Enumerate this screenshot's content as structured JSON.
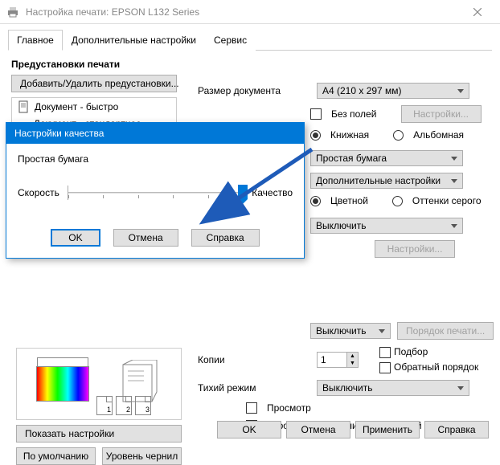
{
  "titlebar": {
    "title": "Настройка печати: EPSON L132 Series"
  },
  "tabs": {
    "main": "Главное",
    "advanced": "Дополнительные настройки",
    "service": "Сервис"
  },
  "presets": {
    "title": "Предустановки печати",
    "add_remove": "Добавить/Удалить предустановки...",
    "items": [
      {
        "label": "Документ - быстро"
      },
      {
        "label": "Документ - стандартное качество"
      }
    ]
  },
  "doc_size": {
    "label": "Размер документа",
    "value": "А4 (210 x 297 мм)"
  },
  "borderless": {
    "label": "Без полей",
    "settings": "Настройки..."
  },
  "orientation": {
    "portrait": "Книжная",
    "landscape": "Альбомная"
  },
  "paper_type": {
    "value": "Простая бумага"
  },
  "advanced_settings": {
    "value": "Дополнительные настройки"
  },
  "color_mode": {
    "color": "Цветной",
    "grayscale": "Оттенки серого"
  },
  "off1": {
    "value": "Выключить"
  },
  "settings_btn": "Настройки...",
  "off2": {
    "value": "Выключить",
    "order_btn": "Порядок печати..."
  },
  "copies": {
    "label": "Копии",
    "value": "1",
    "collate": "Подбор",
    "reverse": "Обратный порядок"
  },
  "quiet": {
    "label": "Тихий режим",
    "value": "Выключить"
  },
  "preview_chk": "Просмотр",
  "organizer_chk": "Упрощенный организатор заданий",
  "show_settings": "Показать настройки",
  "defaults": "По умолчанию",
  "ink_levels": "Уровень чернил",
  "footer": {
    "ok": "OK",
    "cancel": "Отмена",
    "apply": "Применить",
    "help": "Справка"
  },
  "modal": {
    "title": "Настройки качества",
    "paper": "Простая бумага",
    "speed": "Скорость",
    "quality": "Качество",
    "ok": "OK",
    "cancel": "Отмена",
    "help": "Справка"
  }
}
